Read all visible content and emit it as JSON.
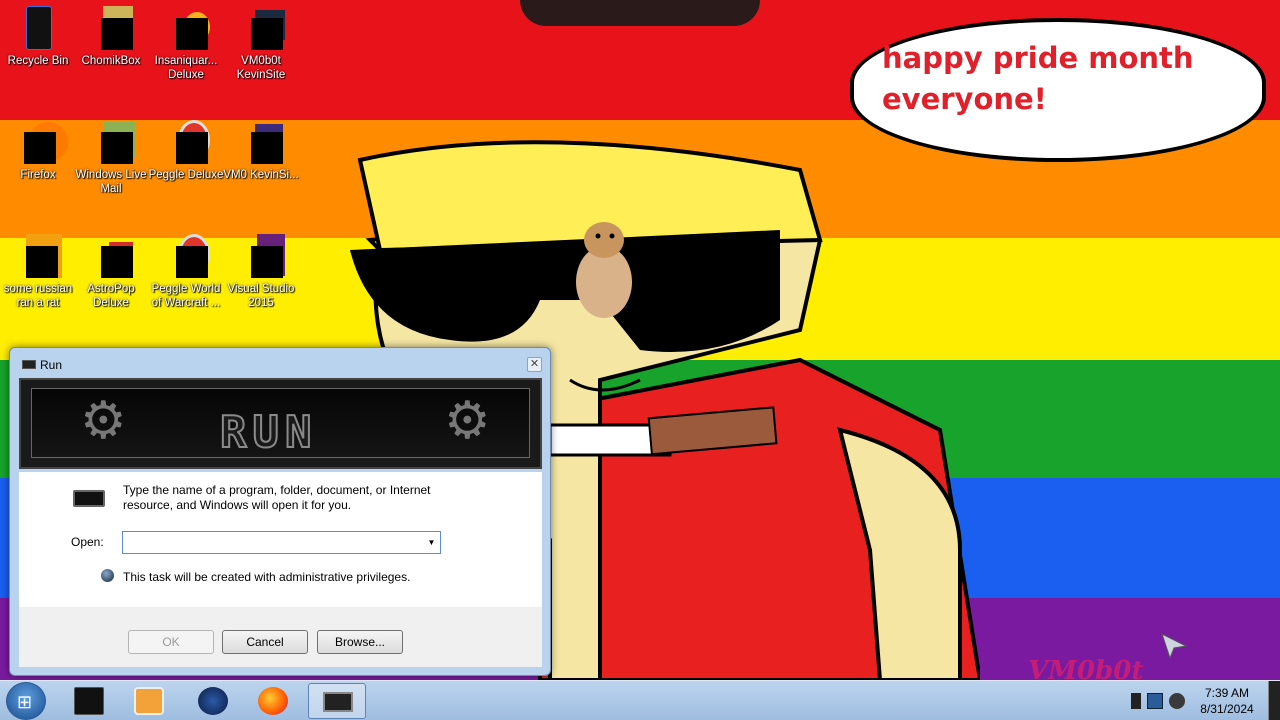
{
  "desktop": {
    "icons": [
      {
        "label": "Recycle Bin"
      },
      {
        "label": "ChomikBox"
      },
      {
        "label": "Insaniquar... Deluxe"
      },
      {
        "label": "VM0b0t KevinSite"
      },
      {
        "label": "Firefox"
      },
      {
        "label": "Windows Live Mail"
      },
      {
        "label": "Peggle Deluxe"
      },
      {
        "label": "VM0 KevinSi..."
      },
      {
        "label": "some russian ran a rat"
      },
      {
        "label": "AstroPop Deluxe"
      },
      {
        "label": "Peggle World of Warcraft ..."
      },
      {
        "label": "Visual Studio 2015"
      }
    ],
    "bubble_text": "happy pride month everyone!",
    "watermark": "VM0b0t"
  },
  "run_dialog": {
    "title": "Run",
    "close_glyph": "✕",
    "logo_text": "RUN",
    "description": "Type the name of a program, folder, document, or Internet resource, and Windows will open it for you.",
    "open_label": "Open:",
    "open_value": "",
    "dropdown_glyph": "▼",
    "admin_note": "This task will be created with administrative privileges.",
    "ok_label": "OK",
    "cancel_label": "Cancel",
    "browse_label": "Browse..."
  },
  "taskbar": {
    "start_glyph": "⊞",
    "pinned": [
      {
        "icon": "cmd-icon"
      },
      {
        "icon": "media-player-icon"
      },
      {
        "icon": "globe-icon"
      },
      {
        "icon": "firefox-icon"
      },
      {
        "icon": "run-icon"
      }
    ],
    "time": "7:39 AM",
    "date": "8/31/2024"
  },
  "colors": {
    "accent": "#e0202a",
    "taskbar": "#bcd4ee"
  }
}
